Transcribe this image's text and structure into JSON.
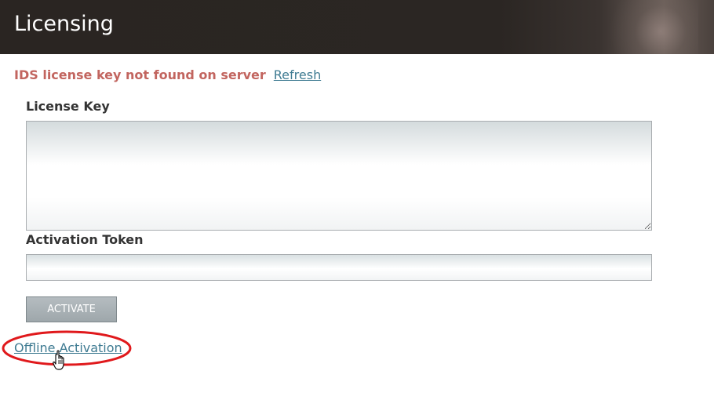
{
  "header": {
    "title": "Licensing"
  },
  "notice": {
    "message": "IDS license key not found on server",
    "refresh_label": "Refresh"
  },
  "form": {
    "license_key_label": "License Key",
    "license_key_value": "",
    "activation_token_label": "Activation Token",
    "activation_token_value": "",
    "activate_label": "ACTIVATE"
  },
  "offline_link_label": "Offline Activation",
  "colors": {
    "error_text": "#c2655f",
    "link": "#3f7b92",
    "highlight": "#e0191c",
    "button": "#a5adb1"
  },
  "icons": [
    "hand-pointer-cursor-icon",
    "red-ellipse-annotation"
  ]
}
